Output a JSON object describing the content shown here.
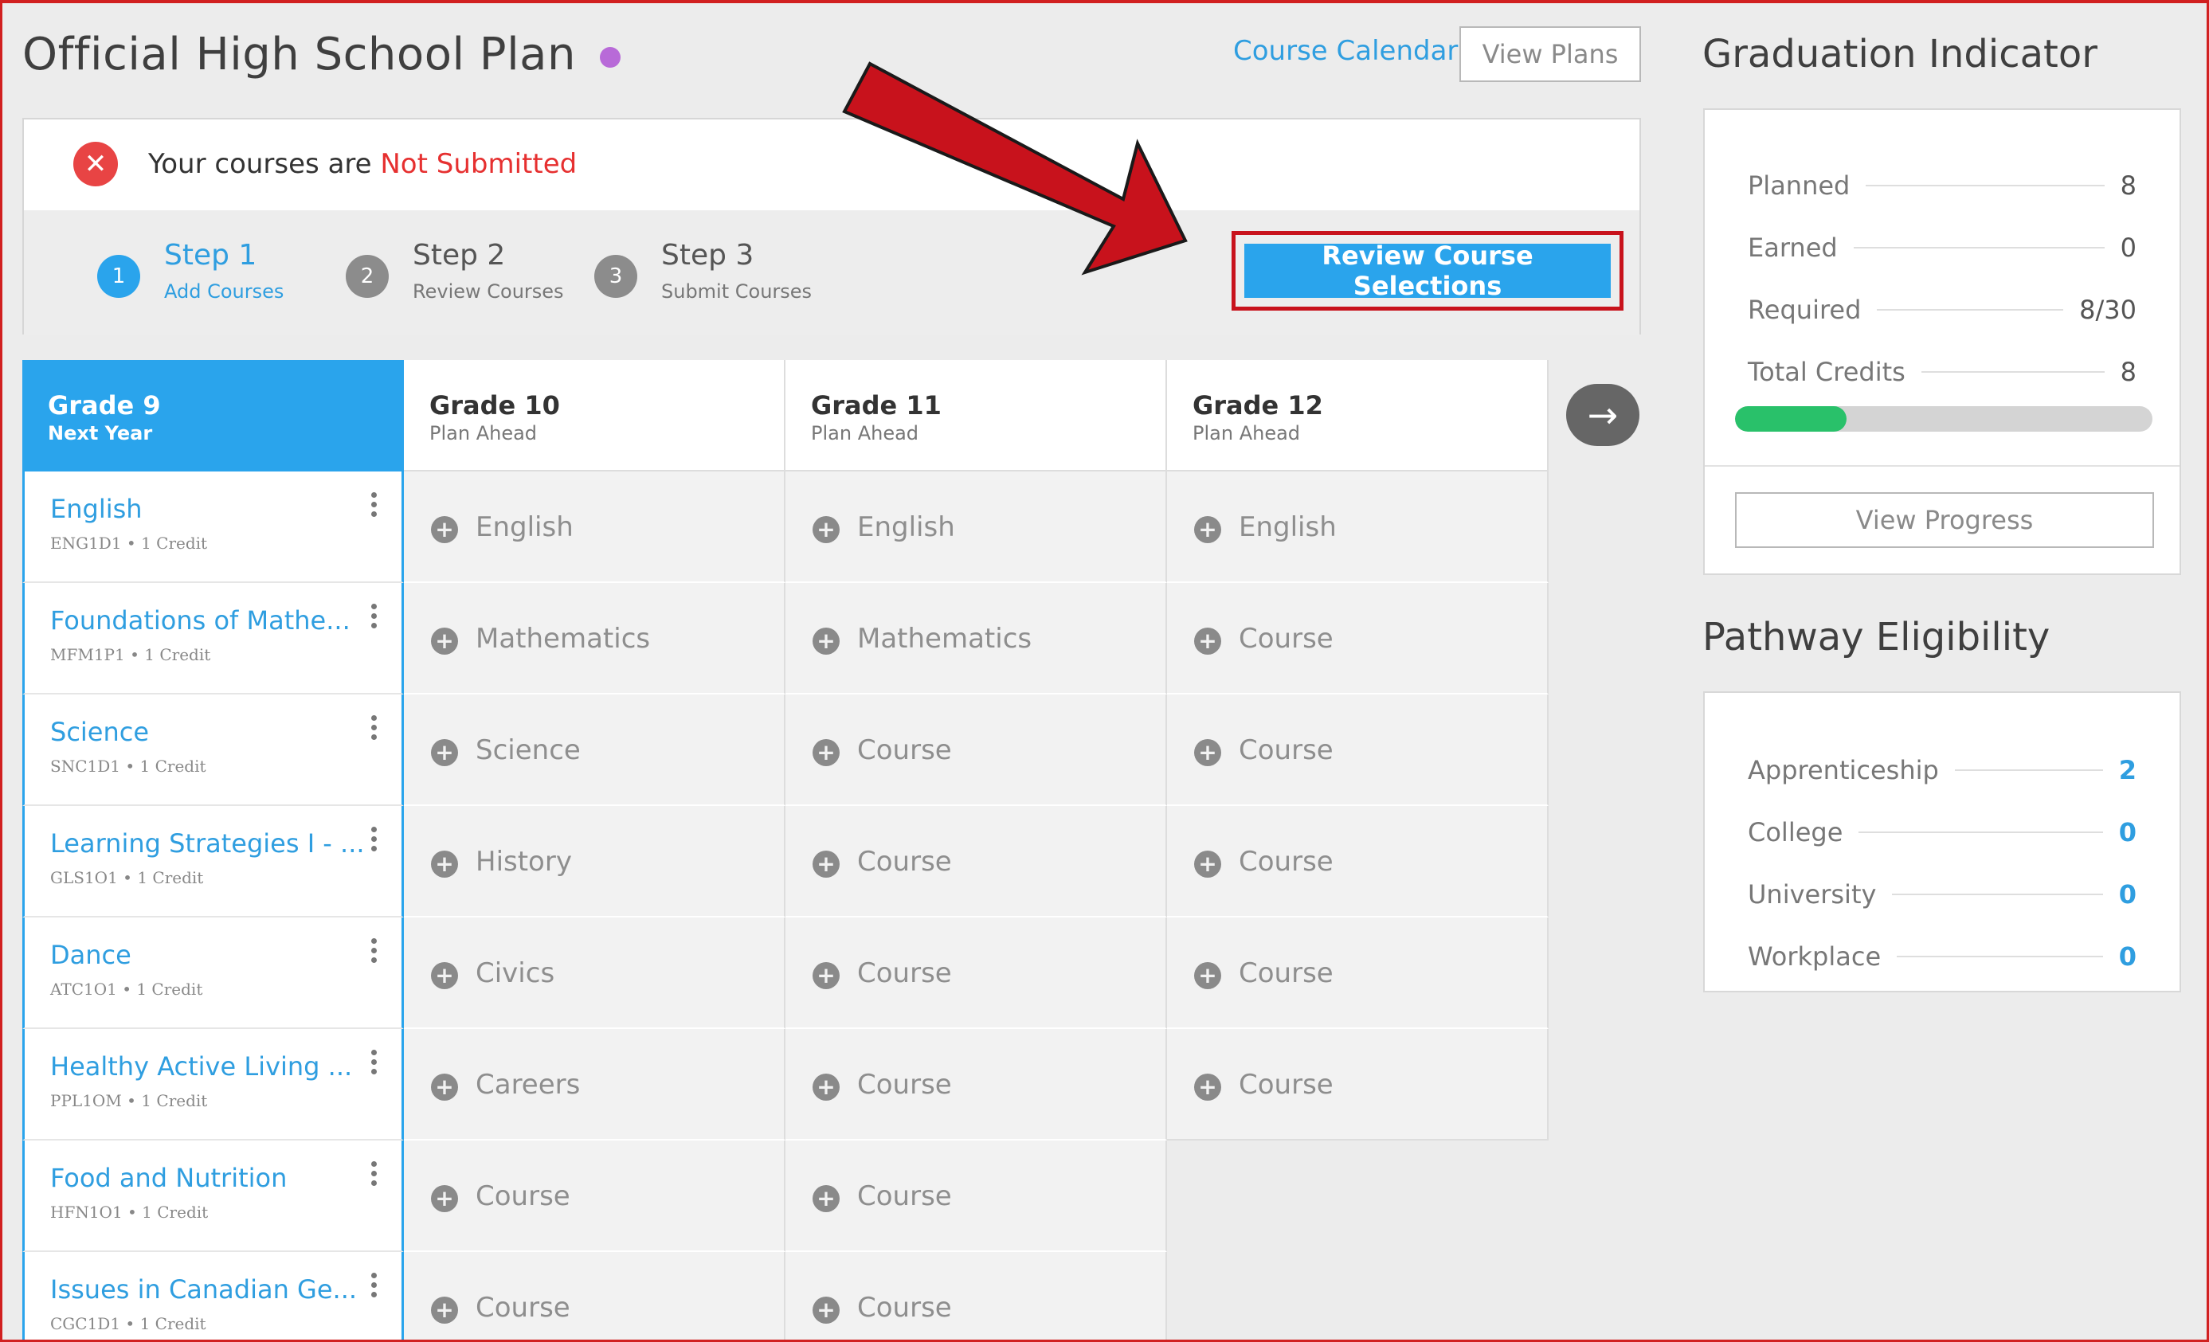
{
  "header": {
    "title": "Official High School Plan",
    "course_calendar": "Course Calendar",
    "view_plans": "View Plans"
  },
  "status": {
    "prefix": "Your courses are",
    "state": "Not Submitted"
  },
  "steps": [
    {
      "num": "1",
      "label": "Step 1",
      "sub": "Add Courses"
    },
    {
      "num": "2",
      "label": "Step 2",
      "sub": "Review Courses"
    },
    {
      "num": "3",
      "label": "Step 3",
      "sub": "Submit Courses"
    }
  ],
  "review_button": "Review Course Selections",
  "grades": [
    {
      "grade": "Grade 9",
      "plan": "Next Year"
    },
    {
      "grade": "Grade 10",
      "plan": "Plan Ahead"
    },
    {
      "grade": "Grade 11",
      "plan": "Plan Ahead"
    },
    {
      "grade": "Grade 12",
      "plan": "Plan Ahead"
    }
  ],
  "grade9_courses": [
    {
      "title": "English",
      "code": "ENG1D1 • 1 Credit"
    },
    {
      "title": "Foundations of Mathe...",
      "code": "MFM1P1 • 1 Credit"
    },
    {
      "title": "Science",
      "code": "SNC1D1 • 1 Credit"
    },
    {
      "title": "Learning Strategies I - ...",
      "code": "GLS1O1 • 1 Credit"
    },
    {
      "title": "Dance",
      "code": "ATC1O1 • 1 Credit"
    },
    {
      "title": "Healthy Active Living ...",
      "code": "PPL1OM • 1 Credit"
    },
    {
      "title": "Food and Nutrition",
      "code": "HFN1O1 • 1 Credit"
    },
    {
      "title": "Issues in Canadian Ge...",
      "code": "CGC1D1 • 1 Credit"
    }
  ],
  "grade10_slots": [
    "English",
    "Mathematics",
    "Science",
    "History",
    "Civics",
    "Careers",
    "Course",
    "Course"
  ],
  "grade11_slots": [
    "English",
    "Mathematics",
    "Course",
    "Course",
    "Course",
    "Course",
    "Course",
    "Course"
  ],
  "grade12_slots": [
    "English",
    "Course",
    "Course",
    "Course",
    "Course",
    "Course"
  ],
  "graduation": {
    "title": "Graduation Indicator",
    "rows": [
      {
        "label": "Planned",
        "value": "8"
      },
      {
        "label": "Earned",
        "value": "0"
      },
      {
        "label": "Required",
        "value": "8/30"
      },
      {
        "label": "Total Credits",
        "value": "8"
      }
    ],
    "progress_fraction": 0.267,
    "view_progress": "View Progress"
  },
  "pathway": {
    "title": "Pathway Eligibility",
    "rows": [
      {
        "label": "Apprenticeship",
        "value": "2"
      },
      {
        "label": "College",
        "value": "0"
      },
      {
        "label": "University",
        "value": "0"
      },
      {
        "label": "Workplace",
        "value": "0"
      }
    ]
  },
  "colors": {
    "accent": "#2aa4ec",
    "error": "#e63030",
    "progress": "#29c16a",
    "annotation": "#c8121c"
  }
}
